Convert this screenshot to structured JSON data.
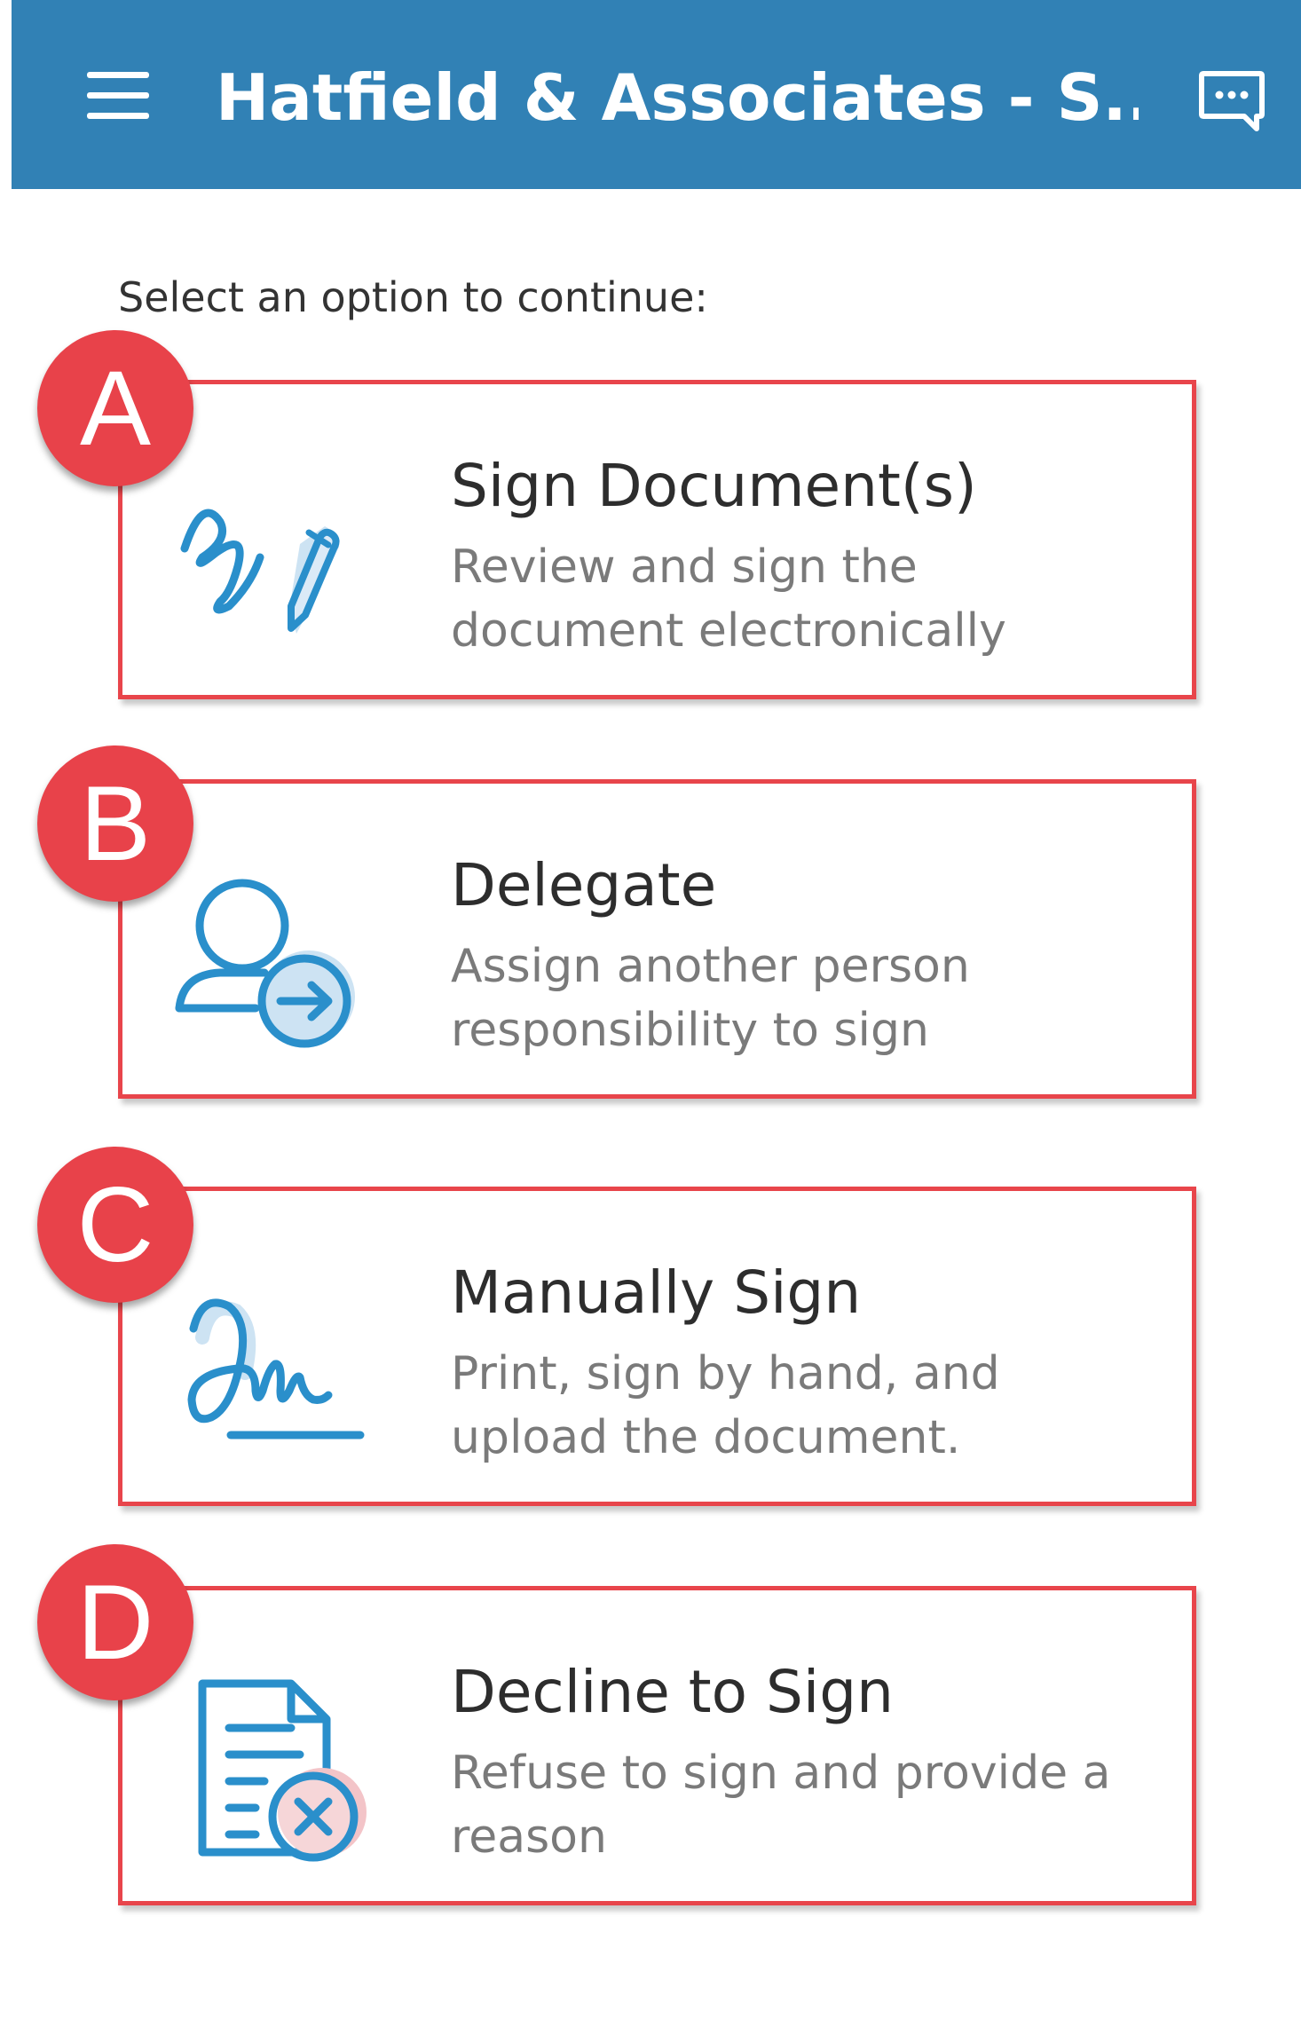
{
  "header": {
    "title": "Hatfield & Associates - S...",
    "menu_icon": "hamburger-menu-icon",
    "chat_icon": "chat-bubble-icon",
    "background_color": "#3181b5"
  },
  "prompt": "Select an option to continue:",
  "options": [
    {
      "badge": "A",
      "title": "Sign Document(s)",
      "description": "Review and sign the document electronically",
      "icon": "pen-signature-icon"
    },
    {
      "badge": "B",
      "title": "Delegate",
      "description": "Assign another person responsibility to sign",
      "icon": "person-arrow-icon"
    },
    {
      "badge": "C",
      "title": "Manually Sign",
      "description": "Print, sign by hand, and upload the document.",
      "icon": "handwritten-signature-icon"
    },
    {
      "badge": "D",
      "title": "Decline to Sign",
      "description": "Refuse to sign and provide a reason",
      "icon": "document-x-icon"
    }
  ],
  "colors": {
    "annotation_red": "#e8424a",
    "icon_blue": "#2a8fcb",
    "icon_fill": "#cde3f3"
  }
}
